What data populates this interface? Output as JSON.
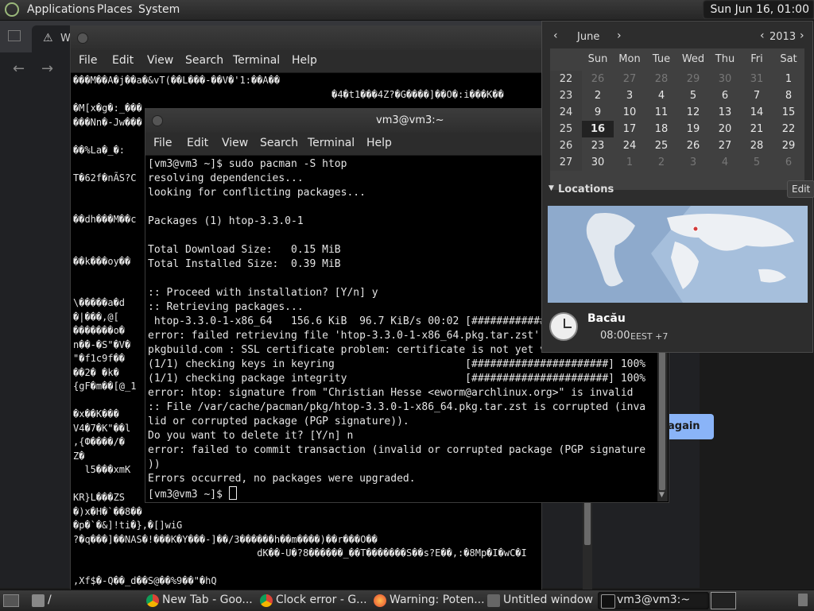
{
  "top_panel": {
    "menus": [
      "Applications",
      "Places",
      "System"
    ],
    "clock": "Sun Jun 16, 01:00"
  },
  "browser_bg": {
    "tab_title": "W",
    "try_again": "again"
  },
  "term_back": {
    "menus": [
      "File",
      "Edit",
      "View",
      "Search",
      "Terminal",
      "Help"
    ],
    "lines": [
      "���M��A�j��a�&vT(��L���-��V�'1:��A��",
      "                                             �4�t1���4Z?�G����]��O�:i���K��",
      "�M[x�g�:_���",
      "���Nn�-Jw���",
      "",
      "��%La�_�:",
      "",
      "T�62f�nÃS?C",
      "",
      "",
      "��dh���M��c",
      "",
      "",
      "��k���oy��",
      "",
      "",
      "\\�����a�d",
      "�|���,@[",
      "�������o�",
      "n��-�S\"�V�",
      "\"�f1c9f��",
      "��2� �k�",
      "{gF�m��[@_1",
      "",
      "�x��K���",
      "V4�7�K\"��l",
      ",{Ф����/�",
      "Z�",
      "  l5���xmK",
      "",
      "KR}L���ZS",
      "�)x�H�`��8��",
      "�p�`�&]!ti�},�[]wiG",
      "?�q���]��NAS�!���K�Y���-]��/3������h��m����)��r���O��",
      "                                dK��-U�?8������_��T�������S��s?E��,:�8Mp�I�wC�I  �",
      "                                                                                  �",
      ",Xf$�-Q��_d��S@��%9��\"�hQ"
    ]
  },
  "term_front": {
    "title": "vm3@vm3:~",
    "menus": [
      "File",
      "Edit",
      "View",
      "Search",
      "Terminal",
      "Help"
    ],
    "lines": [
      "[vm3@vm3 ~]$ sudo pacman -S htop",
      "resolving dependencies...",
      "looking for conflicting packages...",
      "",
      "Packages (1) htop-3.3.0-1",
      "",
      "Total Download Size:   0.15 MiB",
      "Total Installed Size:  0.39 MiB",
      "",
      ":: Proceed with installation? [Y/n] y",
      ":: Retrieving packages...",
      " htop-3.3.0-1-x86_64   156.6 KiB  96.7 KiB/s 00:02 [####################",
      "error: failed retrieving file 'htop-3.3.0-1-x86_64.pkg.tar.zst'",
      "pkgbuild.com : SSL certificate problem: certificate is not yet valid",
      "(1/1) checking keys in keyring                     [######################] 100%",
      "(1/1) checking package integrity                   [######################] 100%",
      "error: htop: signature from \"Christian Hesse <eworm@archlinux.org>\" is invalid",
      ":: File /var/cache/pacman/pkg/htop-3.3.0-1-x86_64.pkg.tar.zst is corrupted (inva",
      "lid or corrupted package (PGP signature)).",
      "Do you want to delete it? [Y/n] n",
      "error: failed to commit transaction (invalid or corrupted package (PGP signature",
      "))",
      "Errors occurred, no packages were upgraded.",
      "[vm3@vm3 ~]$ "
    ]
  },
  "calendar": {
    "month": "June",
    "year": "2013",
    "weekdays": [
      "Sun",
      "Mon",
      "Tue",
      "Wed",
      "Thu",
      "Fri",
      "Sat"
    ],
    "rows": [
      {
        "week": "22",
        "days": [
          "26",
          "27",
          "28",
          "29",
          "30",
          "31",
          "1"
        ]
      },
      {
        "week": "23",
        "days": [
          "2",
          "3",
          "4",
          "5",
          "6",
          "7",
          "8"
        ]
      },
      {
        "week": "24",
        "days": [
          "9",
          "10",
          "11",
          "12",
          "13",
          "14",
          "15"
        ]
      },
      {
        "week": "25",
        "days": [
          "16",
          "17",
          "18",
          "19",
          "20",
          "21",
          "22"
        ]
      },
      {
        "week": "26",
        "days": [
          "23",
          "24",
          "25",
          "26",
          "27",
          "28",
          "29"
        ]
      },
      {
        "week": "27",
        "days": [
          "30",
          "1",
          "2",
          "3",
          "4",
          "5",
          "6"
        ]
      }
    ],
    "today": "16",
    "locations_label": "Locations",
    "edit_label": "Edit",
    "city": "Bacău",
    "city_time": "08:00",
    "city_tz": "EEST +7"
  },
  "taskbar": {
    "items": [
      {
        "label": "/",
        "icon": "folder-icon"
      },
      {
        "label": "New Tab - Goo...",
        "icon": "chrome-icon"
      },
      {
        "label": "Clock error - G...",
        "icon": "chrome-icon"
      },
      {
        "label": "Warning: Poten...",
        "icon": "firefox-icon"
      },
      {
        "label": "Untitled window",
        "icon": "window-icon"
      },
      {
        "label": "vm3@vm3:~",
        "icon": "terminal-icon"
      }
    ]
  }
}
